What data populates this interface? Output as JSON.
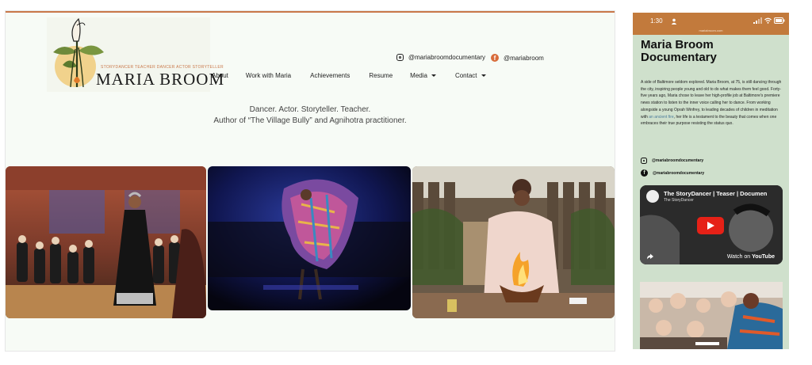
{
  "desktop": {
    "logo": {
      "tagline": "STORYDANCER TEACHER DANCER ACTOR STORYTELLER",
      "name": "MARIA BROOM"
    },
    "social": {
      "instagram_handle": "@mariabroomdocumentary",
      "facebook_handle": "@mariabroom"
    },
    "nav": {
      "items": [
        {
          "label": "About",
          "dropdown": false
        },
        {
          "label": "Work with Maria",
          "dropdown": false
        },
        {
          "label": "Achievements",
          "dropdown": false
        },
        {
          "label": "Resume",
          "dropdown": false
        },
        {
          "label": "Media",
          "dropdown": true
        },
        {
          "label": "Contact",
          "dropdown": true
        }
      ]
    },
    "tagline_line1": "Dancer. Actor. Storyteller. Teacher.",
    "tagline_line2": "Author of “The Village Bully” and Agnihotra practitioner."
  },
  "phone": {
    "time": "1:30",
    "url": "mariabroom.com",
    "title_line1": "Maria Broom",
    "title_line2": "Documentary",
    "body_before_link": "A side of Baltimore seldom explored. Maria Broom, at 75, is still dancing through the city, inspiring people young and old to do what makes them feel good. Forty-five years ago, Maria chose to leave her high-profile job at Baltimore's premiere news station to listen to the inner voice calling her to dance. From working alongside a young Oprah Winfrey, to leading decades of children in meditation with ",
    "body_link": "an ancient fire",
    "body_after_link": ", her life is a testament to the beauty that comes when one embraces their true purpose resisting the status quo.",
    "instagram_handle": "@mariabroomdocumentary",
    "facebook_handle": "@mariabroomdocumentary",
    "video": {
      "title": "The StoryDancer | Teaser | Documen",
      "channel": "The StoryDancer",
      "watch_prefix": "Watch on",
      "watch_brand": "YouTube"
    }
  },
  "colors": {
    "accent": "#c9784a",
    "phone_bg": "#cfe0cc",
    "status_bar": "#c27a3c"
  }
}
